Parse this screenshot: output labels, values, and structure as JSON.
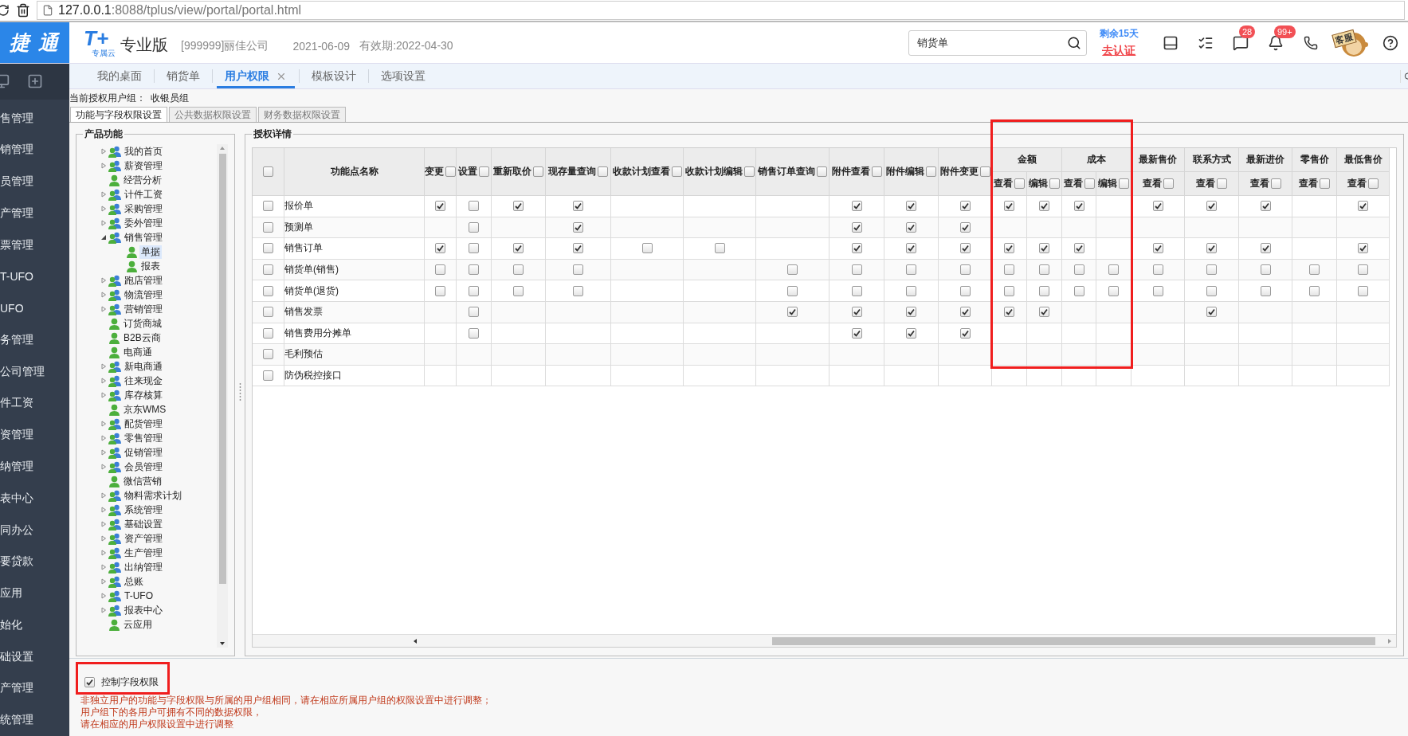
{
  "browser": {
    "url_host": "127.0.0.1",
    "url_path": ":8088/tplus/view/portal/portal.html"
  },
  "header": {
    "brand": "捷 通",
    "logo": "T+",
    "logo_sub": "专属云",
    "edition": "专业版",
    "company": "[999999]丽佳公司",
    "date": "2021-06-09",
    "validity": "有效期:2022-04-30",
    "search": {
      "value": "销货单"
    },
    "trial": "剩余15天",
    "certify": "去认证",
    "tools": [
      {
        "kind": "device"
      },
      {
        "kind": "tasks"
      },
      {
        "kind": "message",
        "badge": "28"
      },
      {
        "kind": "bell",
        "badge": "99+"
      },
      {
        "kind": "phone"
      },
      {
        "kind": "service",
        "label": "客服"
      },
      {
        "kind": "help"
      }
    ]
  },
  "sidebar": {
    "items": [
      "售管理",
      "销管理",
      "员管理",
      "产管理",
      "票管理",
      "T-UFO",
      "UFO",
      "务管理",
      "公司管理",
      "件工资",
      "资管理",
      "纳管理",
      "表中心",
      "同办公",
      "要贷款",
      "应用",
      "始化",
      "础设置",
      "产管理",
      "统管理"
    ]
  },
  "tabs": [
    {
      "label": "我的桌面",
      "selected": false,
      "closable": false
    },
    {
      "label": "销货单",
      "selected": false,
      "closable": false
    },
    {
      "label": "用户权限",
      "selected": true,
      "closable": true
    },
    {
      "label": "模板设计",
      "selected": false,
      "closable": false
    },
    {
      "label": "选项设置",
      "selected": false,
      "closable": false
    }
  ],
  "user_group": {
    "label": "当前授权用户组：",
    "value": "收银员组"
  },
  "subtabs": [
    {
      "label": "功能与字段权限设置",
      "selected": true
    },
    {
      "label": "公共数据权限设置",
      "selected": false
    },
    {
      "label": "财务数据权限设置",
      "selected": false
    }
  ],
  "product_panel": {
    "title": "产品功能",
    "tree": [
      {
        "label": "我的首页",
        "kind": "group",
        "expanded": false,
        "selected": false
      },
      {
        "label": "薪资管理",
        "kind": "group",
        "expanded": false,
        "selected": false
      },
      {
        "label": "经营分析",
        "kind": "leaf",
        "selected": false
      },
      {
        "label": "计件工资",
        "kind": "group",
        "expanded": false,
        "selected": false
      },
      {
        "label": "采购管理",
        "kind": "group",
        "expanded": false,
        "selected": false
      },
      {
        "label": "委外管理",
        "kind": "group",
        "expanded": false,
        "selected": false
      },
      {
        "label": "销售管理",
        "kind": "group",
        "expanded": true,
        "selected": false,
        "children": [
          {
            "label": "单据",
            "kind": "leaf",
            "selected": true
          },
          {
            "label": "报表",
            "kind": "leaf",
            "selected": false
          }
        ]
      },
      {
        "label": "跑店管理",
        "kind": "group",
        "expanded": false,
        "selected": false
      },
      {
        "label": "物流管理",
        "kind": "group",
        "expanded": false,
        "selected": false
      },
      {
        "label": "营销管理",
        "kind": "group",
        "expanded": false,
        "selected": false
      },
      {
        "label": "订货商城",
        "kind": "leaf",
        "selected": false
      },
      {
        "label": "B2B云商",
        "kind": "leaf",
        "selected": false
      },
      {
        "label": "电商通",
        "kind": "leaf",
        "selected": false
      },
      {
        "label": "新电商通",
        "kind": "group",
        "expanded": false,
        "selected": false
      },
      {
        "label": "往来现金",
        "kind": "group",
        "expanded": false,
        "selected": false
      },
      {
        "label": "库存核算",
        "kind": "group",
        "expanded": false,
        "selected": false
      },
      {
        "label": "京东WMS",
        "kind": "leaf",
        "selected": false
      },
      {
        "label": "配货管理",
        "kind": "group",
        "expanded": false,
        "selected": false
      },
      {
        "label": "零售管理",
        "kind": "group",
        "expanded": false,
        "selected": false
      },
      {
        "label": "促销管理",
        "kind": "group",
        "expanded": false,
        "selected": false
      },
      {
        "label": "会员管理",
        "kind": "group",
        "expanded": false,
        "selected": false
      },
      {
        "label": "微信营销",
        "kind": "leaf",
        "selected": false
      },
      {
        "label": "物料需求计划",
        "kind": "group",
        "expanded": false,
        "selected": false
      },
      {
        "label": "系统管理",
        "kind": "group",
        "expanded": false,
        "selected": false
      },
      {
        "label": "基础设置",
        "kind": "group",
        "expanded": false,
        "selected": false
      },
      {
        "label": "资产管理",
        "kind": "group",
        "expanded": false,
        "selected": false
      },
      {
        "label": "生产管理",
        "kind": "group",
        "expanded": false,
        "selected": false
      },
      {
        "label": "出纳管理",
        "kind": "group",
        "expanded": false,
        "selected": false
      },
      {
        "label": "总账",
        "kind": "group",
        "expanded": false,
        "selected": false
      },
      {
        "label": "T-UFO",
        "kind": "group",
        "expanded": false,
        "selected": false
      },
      {
        "label": "报表中心",
        "kind": "group",
        "expanded": false,
        "selected": false
      },
      {
        "label": "云应用",
        "kind": "leaf",
        "selected": false
      }
    ]
  },
  "detail_panel": {
    "title": "授权详情",
    "all_checked": false,
    "name_column": "功能点名称",
    "columns": [
      {
        "label": "变更",
        "checked": false
      },
      {
        "label": "设置",
        "checked": false
      },
      {
        "label": "重新取价",
        "checked": false
      },
      {
        "label": "现存量查询",
        "checked": false
      },
      {
        "label": "收款计划查看",
        "checked": false
      },
      {
        "label": "收款计划编辑",
        "checked": false
      },
      {
        "label": "销售订单查询",
        "checked": false
      },
      {
        "label": "附件查看",
        "checked": false
      },
      {
        "label": "附件编辑",
        "checked": false
      },
      {
        "label": "附件变更",
        "checked": false
      }
    ],
    "field_groups": [
      {
        "label": "金额",
        "framed": true,
        "subs": [
          {
            "label": "查看",
            "checked": false
          },
          {
            "label": "编辑",
            "checked": false
          }
        ]
      },
      {
        "label": "成本",
        "framed": true,
        "subs": [
          {
            "label": "查看",
            "checked": false
          },
          {
            "label": "编辑",
            "checked": false
          }
        ]
      },
      {
        "label": "最新售价",
        "framed": false,
        "subs": [
          {
            "label": "查看",
            "checked": false
          }
        ]
      },
      {
        "label": "联系方式",
        "framed": false,
        "subs": [
          {
            "label": "查看",
            "checked": false
          }
        ]
      },
      {
        "label": "最新进价",
        "framed": false,
        "subs": [
          {
            "label": "查看",
            "checked": false
          }
        ]
      },
      {
        "label": "零售价",
        "framed": false,
        "subs": [
          {
            "label": "查看",
            "checked": false
          }
        ]
      },
      {
        "label": "最低售价",
        "framed": false,
        "subs": [
          {
            "label": "查看",
            "checked": false
          }
        ]
      }
    ],
    "rows": [
      {
        "label": "报价单",
        "checked": false,
        "cells": [
          true,
          false,
          true,
          true,
          null,
          null,
          null,
          true,
          true,
          true,
          true,
          true,
          true,
          null,
          true,
          true,
          true,
          null,
          true
        ]
      },
      {
        "label": "预测单",
        "checked": false,
        "cells": [
          null,
          false,
          null,
          true,
          null,
          null,
          null,
          true,
          true,
          true,
          null,
          null,
          null,
          null,
          null,
          null,
          null,
          null,
          null
        ]
      },
      {
        "label": "销售订单",
        "checked": false,
        "cells": [
          true,
          false,
          true,
          true,
          false,
          false,
          null,
          true,
          true,
          true,
          true,
          true,
          true,
          null,
          true,
          true,
          true,
          null,
          true
        ]
      },
      {
        "label": "销货单(销售)",
        "checked": false,
        "cells": [
          false,
          false,
          false,
          false,
          null,
          null,
          false,
          false,
          false,
          false,
          false,
          false,
          false,
          false,
          false,
          false,
          false,
          false,
          false
        ]
      },
      {
        "label": "销货单(退货)",
        "checked": false,
        "cells": [
          false,
          false,
          false,
          false,
          null,
          null,
          false,
          false,
          false,
          false,
          false,
          false,
          false,
          false,
          false,
          false,
          false,
          false,
          false
        ]
      },
      {
        "label": "销售发票",
        "checked": false,
        "cells": [
          null,
          false,
          null,
          null,
          null,
          null,
          true,
          true,
          true,
          true,
          true,
          true,
          null,
          null,
          null,
          true,
          null,
          null,
          null
        ]
      },
      {
        "label": "销售费用分摊单",
        "checked": false,
        "cells": [
          null,
          false,
          null,
          null,
          null,
          null,
          null,
          true,
          true,
          true,
          null,
          null,
          null,
          null,
          null,
          null,
          null,
          null,
          null
        ]
      },
      {
        "label": "毛利预估",
        "checked": false,
        "cells": [
          null,
          null,
          null,
          null,
          null,
          null,
          null,
          null,
          null,
          null,
          null,
          null,
          null,
          null,
          null,
          null,
          null,
          null,
          null
        ]
      },
      {
        "label": "防伪税控接口",
        "checked": false,
        "cells": [
          null,
          null,
          null,
          null,
          null,
          null,
          null,
          null,
          null,
          null,
          null,
          null,
          null,
          null,
          null,
          null,
          null,
          null,
          null
        ]
      }
    ]
  },
  "footer": {
    "control": {
      "label": "控制字段权限",
      "checked": true,
      "framed": true
    },
    "notes": [
      "非独立用户的功能与字段权限与所属的用户组相同，请在相应所属用户组的权限设置中进行调整；",
      "用户组下的各用户可拥有不同的数据权限，",
      "请在相应的用户权限设置中进行调整"
    ]
  }
}
